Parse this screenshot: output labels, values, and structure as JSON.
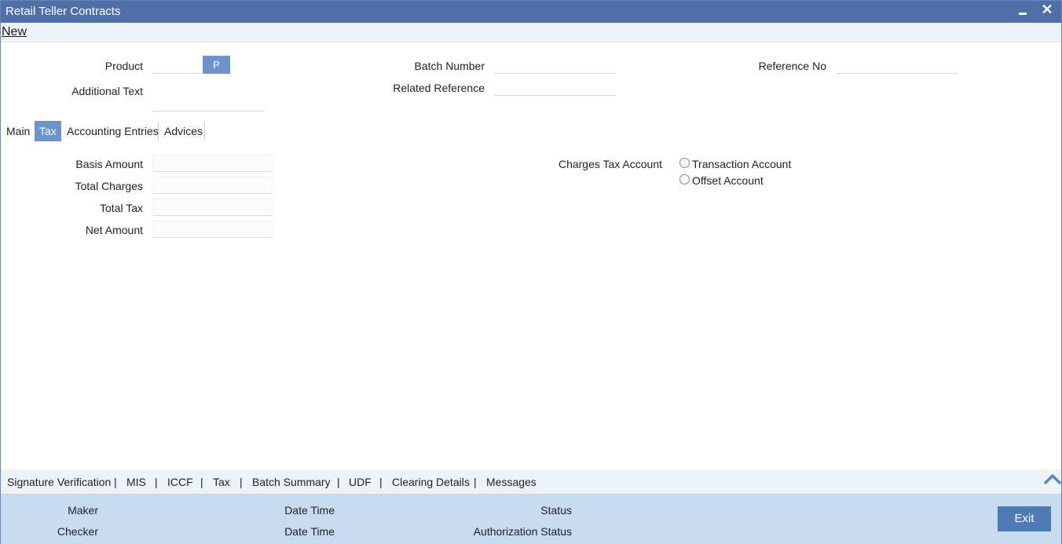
{
  "window": {
    "title": "Retail Teller Contracts"
  },
  "toolbar": {
    "new_label": "New"
  },
  "header": {
    "product_label": "Product",
    "product_value": "",
    "product_button": "P",
    "additional_text_label": "Additional Text",
    "additional_text_value": "",
    "batch_number_label": "Batch Number",
    "batch_number_value": "",
    "related_reference_label": "Related Reference",
    "related_reference_value": "",
    "reference_no_label": "Reference No",
    "reference_no_value": ""
  },
  "tabs": [
    {
      "label": "Main",
      "active": false
    },
    {
      "label": "Tax",
      "active": true
    },
    {
      "label": "Accounting Entries",
      "active": false
    },
    {
      "label": "Advices",
      "active": false
    }
  ],
  "tax": {
    "basis_amount_label": "Basis Amount",
    "basis_amount_value": "",
    "total_charges_label": "Total Charges",
    "total_charges_value": "",
    "total_tax_label": "Total Tax",
    "total_tax_value": "",
    "net_amount_label": "Net Amount",
    "net_amount_value": "",
    "charges_tax_account_label": "Charges Tax Account",
    "options": [
      "Transaction Account",
      "Offset Account"
    ]
  },
  "links": [
    "Signature Verification",
    "MIS",
    "ICCF",
    "Tax",
    "Batch Summary",
    "UDF",
    "Clearing Details",
    "Messages"
  ],
  "footer": {
    "maker_label": "Maker",
    "checker_label": "Checker",
    "date_time_label": "Date Time",
    "status_label": "Status",
    "authorization_status_label": "Authorization Status",
    "exit_label": "Exit"
  },
  "colors": {
    "titlebar": "#4e6fa8",
    "accent": "#6d93cc",
    "footer": "#c7dbef",
    "exit_button": "#4e7bb6"
  },
  "icons": {
    "minimize": "minimize-icon",
    "close": "close-icon",
    "scroll_up": "chevron-up-icon"
  }
}
